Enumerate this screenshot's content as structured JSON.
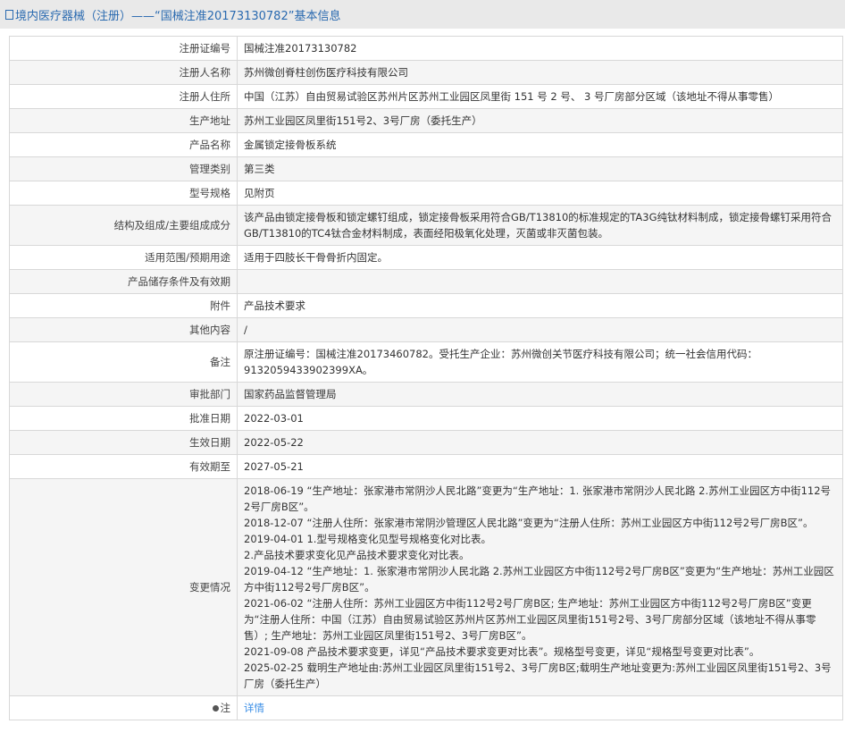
{
  "title": "境内医疗器械（注册）——“国械注准20173130782”基本信息",
  "rows": [
    {
      "label": "注册证编号",
      "value": "国械注准20173130782"
    },
    {
      "label": "注册人名称",
      "value": "苏州微创脊柱创伤医疗科技有限公司"
    },
    {
      "label": "注册人住所",
      "value": "中国（江苏）自由贸易试验区苏州片区苏州工业园区凤里街 151 号 2 号、 3 号厂房部分区域（该地址不得从事零售）"
    },
    {
      "label": "生产地址",
      "value": "苏州工业园区凤里街151号2、3号厂房（委托生产）"
    },
    {
      "label": "产品名称",
      "value": "金属锁定接骨板系统"
    },
    {
      "label": "管理类别",
      "value": "第三类"
    },
    {
      "label": "型号规格",
      "value": "见附页"
    },
    {
      "label": "结构及组成/主要组成成分",
      "value": "该产品由锁定接骨板和锁定螺钉组成，锁定接骨板采用符合GB/T13810的标准规定的TA3G纯钛材料制成，锁定接骨螺钉采用符合GB/T13810的TC4钛合金材料制成，表面经阳极氧化处理，灭菌或非灭菌包装。"
    },
    {
      "label": "适用范围/预期用途",
      "value": "适用于四肢长干骨骨折内固定。"
    },
    {
      "label": "产品储存条件及有效期",
      "value": ""
    },
    {
      "label": "附件",
      "value": "产品技术要求"
    },
    {
      "label": "其他内容",
      "value": "/"
    },
    {
      "label": "备注",
      "value": "原注册证编号：国械注准20173460782。受托生产企业：苏州微创关节医疗科技有限公司；统一社会信用代码：91320594339023​99XA。"
    },
    {
      "label": "审批部门",
      "value": "国家药品监督管理局"
    },
    {
      "label": "批准日期",
      "value": "2022-03-01"
    },
    {
      "label": "生效日期",
      "value": "2022-05-22"
    },
    {
      "label": "有效期至",
      "value": "2027-05-21"
    }
  ],
  "changes": {
    "label": "变更情况",
    "lines": [
      "2018-06-19 “生产地址：张家港市常阴沙人民北路”变更为“生产地址：1. 张家港市常阴沙人民北路 2.苏州工业园区方中街112号2号厂房B区”。",
      "2018-12-07 “注册人住所：张家港市常阴沙管理区人民北路”变更为“注册人住所：苏州工业园区方中街112号2号厂房B区”。",
      "2019-04-01 1.型号规格变化见型号规格变化对比表。",
      "2.产品技术要求变化见产品技术要求变化对比表。",
      "2019-04-12 “生产地址：1. 张家港市常阴沙人民北路 2.苏州工业园区方中街112号2号厂房B区”变更为“生产地址：苏州工业园区方中街112号2号厂房B区”。",
      "2021-06-02 “注册人住所：苏州工业园区方中街112号2号厂房B区; 生产地址：苏州工业园区方中街112号2号厂房B区”变更为“注册人住所：中国（江苏）自由贸易试验区苏州片区苏州工业园区凤里街151号2号、3号厂房部分区域（该地址不得从事零售）; 生产地址：苏州工业园区凤里街151号2、3号厂房B区”。",
      "2021-09-08 产品技术要求变更，详见“产品技术要求变更对比表”。规格型号变更，详见“规格型号变更对比表”。",
      "2025-02-25 载明生产地址由:苏州工业园区凤里街151号2、3号厂房B区;载明生产地址变更为:苏州工业园区凤里街151号2、3号厂房（委托生产）"
    ]
  },
  "note": {
    "label": "注",
    "link": "详情"
  }
}
